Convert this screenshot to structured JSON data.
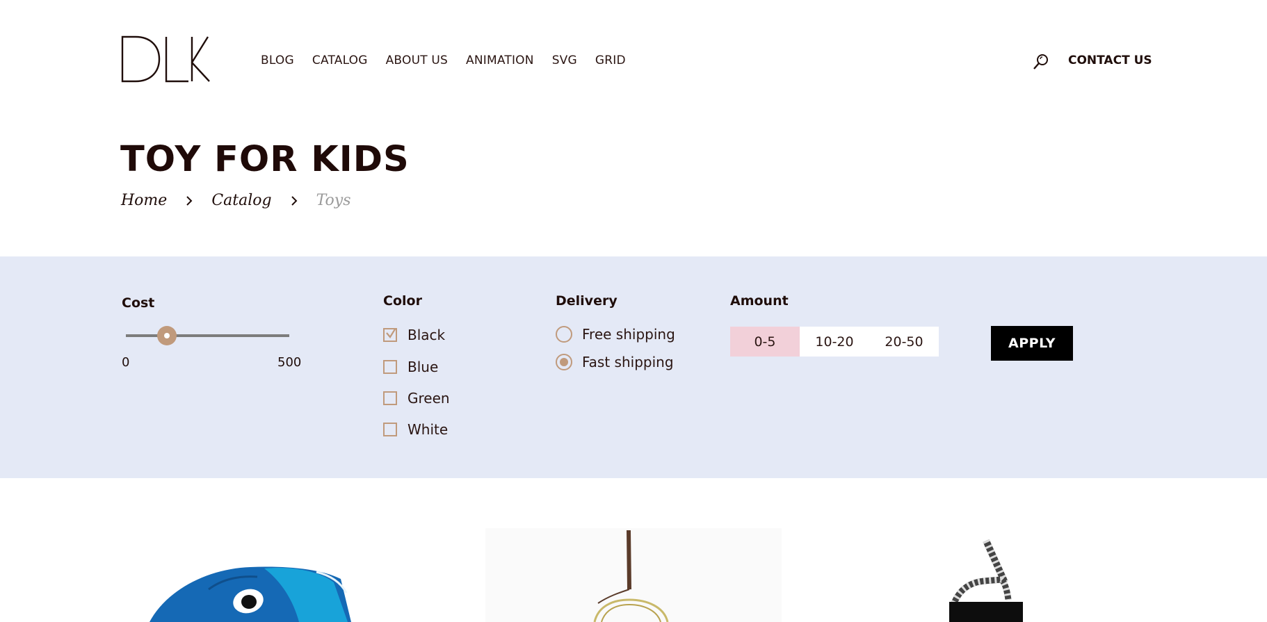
{
  "brand": {
    "logo": "DLK"
  },
  "nav": {
    "items": [
      "BLOG",
      "CATALOG",
      "ABOUT US",
      "ANIMATION",
      "SVG",
      "GRID"
    ]
  },
  "header": {
    "contact": "CONTACT US"
  },
  "page": {
    "title": "TOY FOR KIDS"
  },
  "breadcrumb": {
    "items": [
      "Home",
      "Catalog"
    ],
    "current": "Toys"
  },
  "filters": {
    "cost": {
      "label": "Cost",
      "min": "0",
      "max": "500",
      "value_fraction": 0.25
    },
    "color": {
      "label": "Color",
      "options": [
        {
          "label": "Black",
          "checked": true
        },
        {
          "label": "Blue",
          "checked": false
        },
        {
          "label": "Green",
          "checked": false
        },
        {
          "label": "White",
          "checked": false
        }
      ]
    },
    "delivery": {
      "label": "Delivery",
      "options": [
        {
          "label": "Free shipping",
          "selected": false
        },
        {
          "label": "Fast shipping",
          "selected": true
        }
      ]
    },
    "amount": {
      "label": "Amount",
      "options": [
        "0-5",
        "10-20",
        "20-50"
      ],
      "selected": "0-5"
    },
    "apply_label": "APPLY"
  },
  "colors": {
    "accent": "#c09a7c",
    "filter_bg": "#e4e9f6",
    "selected_amount": "#f2d0d9",
    "text": "#1f0d0a"
  }
}
